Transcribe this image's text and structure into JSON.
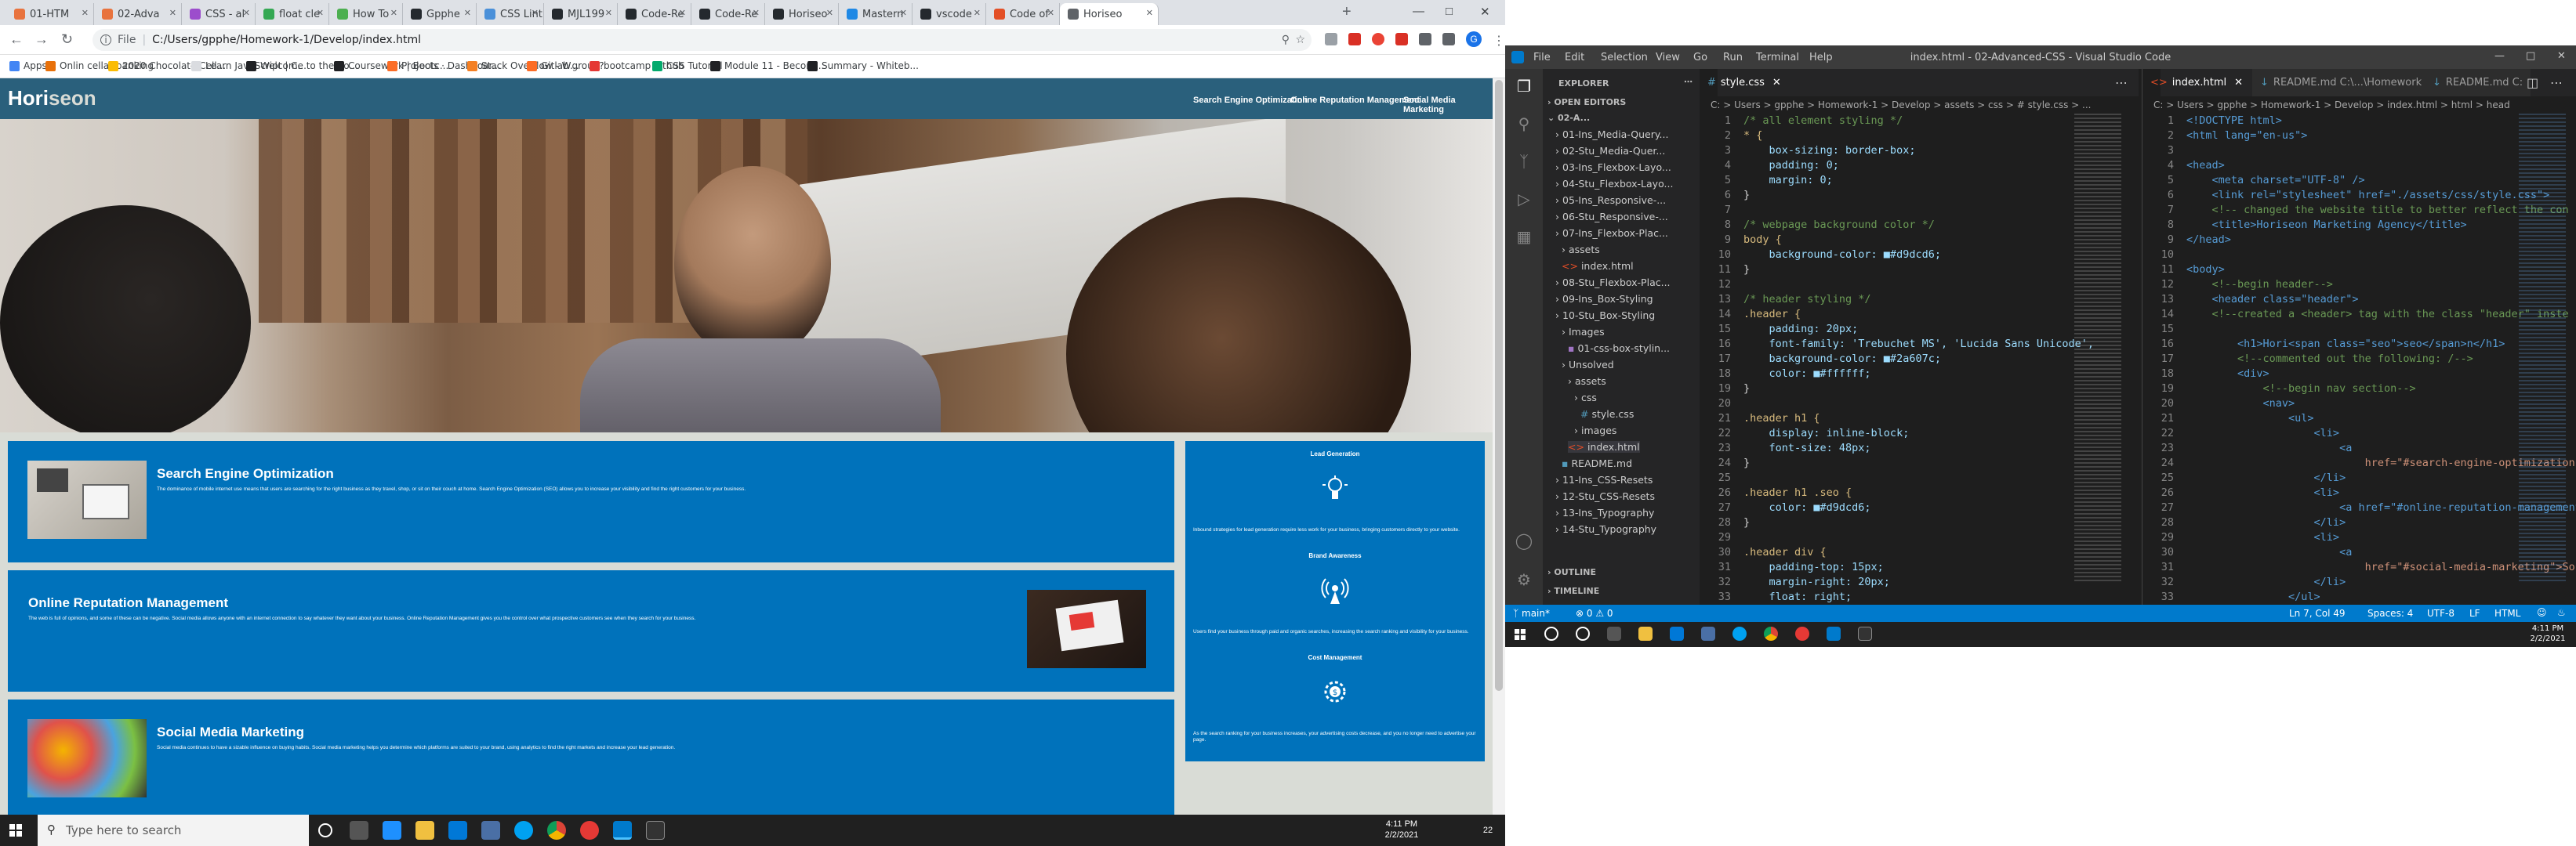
{
  "chrome": {
    "tabs": [
      {
        "label": "01-HTM",
        "color": "#e8733e"
      },
      {
        "label": "02-Adva",
        "color": "#e8733e"
      },
      {
        "label": "CSS - al",
        "color": "#9c4dcc"
      },
      {
        "label": "float cle",
        "color": "#34a853"
      },
      {
        "label": "How To",
        "color": "#4caf50"
      },
      {
        "label": "Gpphe",
        "color": "#24292e"
      },
      {
        "label": "CSS Lint",
        "color": "#4a90d9"
      },
      {
        "label": "MJL199",
        "color": "#24292e"
      },
      {
        "label": "Code-Re",
        "color": "#24292e"
      },
      {
        "label": "Code-Re",
        "color": "#24292e"
      },
      {
        "label": "Horiseo",
        "color": "#24292e"
      },
      {
        "label": "Mastern",
        "color": "#1e88e5"
      },
      {
        "label": "vscode",
        "color": "#24292e"
      },
      {
        "label": "Code of",
        "color": "#e34f26"
      },
      {
        "label": "Horiseo",
        "color": "#5f6368"
      }
    ],
    "address": "C:/Users/gpphe/Homework-1/Develop/index.html",
    "address_prefix": "File",
    "bookmarks": [
      {
        "label": "Apps",
        "color": "#4285f4"
      },
      {
        "label": "Onlin cellar banking",
        "color": "#e8710a"
      },
      {
        "label": "2020 Chocolate Cell...",
        "color": "#fbbc04"
      },
      {
        "label": "Learn JavaScript | C...",
        "color": "#dadce0"
      },
      {
        "label": "Welcome to the Bo...",
        "color": "#202124"
      },
      {
        "label": "Coursework | Bootc...",
        "color": "#202124"
      },
      {
        "label": "Projects · Dashboar...",
        "color": "#fc6d26"
      },
      {
        "label": "Stack Overflow - W...",
        "color": "#f48024"
      },
      {
        "label": "Gitlab group?",
        "color": "#fc6d26"
      },
      {
        "label": "bootcamp github",
        "color": "#e53935"
      },
      {
        "label": "CSS Tutorial",
        "color": "#04aa6d"
      },
      {
        "label": "Module 11 - Becom...",
        "color": "#202124"
      },
      {
        "label": "Summary - Whiteb...",
        "color": "#202124"
      }
    ]
  },
  "site": {
    "title": "Hori",
    "title_seo": "seon",
    "nav": [
      "Search Engine Optimization",
      "Online Reputation Management",
      "Social Media Marketing"
    ],
    "sections": [
      {
        "title": "Search Engine Optimization",
        "text": "The dominance of mobile internet use means that users are searching for the right business as they travel, shop, or sit on their couch at home. Search Engine Optimization (SEO) allows you to increase your visibility and find the right customers for your business."
      },
      {
        "title": "Online Reputation Management",
        "text": "The web is full of opinions, and some of these can be negative. Social media allows anyone with an internet connection to say whatever they want about your business. Online Reputation Management gives you the control over what prospective customers see when they search for your business."
      },
      {
        "title": "Social Media Marketing",
        "text": "Social media continues to have a sizable influence on buying habits. Social media marketing helps you determine which platforms are suited to your brand, using analytics to find the right markets and increase your lead generation."
      }
    ],
    "benefits": [
      {
        "title": "Lead Generation",
        "text": "Inbound strategies for lead generation require less work for your business, bringing customers directly to your website."
      },
      {
        "title": "Brand Awareness",
        "text": "Users find your business through paid and organic searches, increasing the search ranking and visibility for your business."
      },
      {
        "title": "Cost Management",
        "text": "As the search ranking for your business increases, your advertising costs decrease, and you no longer need to advertise your page."
      }
    ]
  },
  "taskbar": {
    "search_placeholder": "Type here to search",
    "time": "4:11 PM",
    "date": "2/2/2021",
    "notif_count": "22"
  },
  "vscode": {
    "title": "index.html - 02-Advanced-CSS - Visual Studio Code",
    "menu": [
      "File",
      "Edit",
      "Selection",
      "View",
      "Go",
      "Run",
      "Terminal",
      "Help"
    ],
    "explorer_title": "EXPLORER",
    "open_editors": "OPEN EDITORS",
    "folder": "02-A...",
    "tree": [
      "01-Ins_Media-Query...",
      "02-Stu_Media-Quer...",
      "03-Ins_Flexbox-Layo...",
      "04-Stu_Flexbox-Layo...",
      "05-Ins_Responsive-...",
      "06-Stu_Responsive-...",
      "07-Ins_Flexbox-Plac...",
      "assets",
      "index.html",
      "08-Stu_Flexbox-Plac...",
      "09-Ins_Box-Styling",
      "10-Stu_Box-Styling",
      "Images",
      "01-css-box-stylin...",
      "Unsolved",
      "assets",
      "css",
      "style.css",
      "images",
      "index.html",
      "README.md",
      "11-Ins_CSS-Resets",
      "12-Stu_CSS-Resets",
      "13-Ins_Typography",
      "14-Stu_Typography"
    ],
    "outline": "OUTLINE",
    "timeline": "TIMELINE",
    "left_tab": "style.css",
    "left_crumb": "C: > Users > gpphe > Homework-1 > Develop > assets > css > # style.css > ...",
    "left_code": [
      "/* all element styling */",
      "* {",
      "    box-sizing: border-box;",
      "    padding: 0;",
      "    margin: 0;",
      "}",
      "",
      "/* webpage background color */",
      "body {",
      "    background-color: ■#d9dcd6;",
      "}",
      "",
      "/* header styling */",
      ".header {",
      "    padding: 20px;",
      "    font-family: 'Trebuchet MS', 'Lucida Sans Unicode',",
      "    background-color: ■#2a607c;",
      "    color: ■#ffffff;",
      "}",
      "",
      ".header h1 {",
      "    display: inline-block;",
      "    font-size: 48px;",
      "}",
      "",
      ".header h1 .seo {",
      "    color: ■#d9dcd6;",
      "}",
      "",
      ".header div {",
      "    padding-top: 15px;",
      "    margin-right: 20px;",
      "    float: right;"
    ],
    "right_tabs": [
      "index.html",
      "README.md C:\\...\\Homework",
      "README.md C:"
    ],
    "right_crumb": "C: > Users > gpphe > Homework-1 > Develop > index.html > html > head",
    "right_code": [
      "<!DOCTYPE html>",
      "<html lang=\"en-us\">",
      "",
      "<head>",
      "    <meta charset=\"UTF-8\" />",
      "    <link rel=\"stylesheet\" href=\"./assets/css/style.css\">",
      "    <!-- changed the website title to better reflect the con",
      "    <title>Horiseon Marketing Agency</title>",
      "</head>",
      "",
      "<body>",
      "    <!--begin header-->",
      "    <header class=\"header\">",
      "    <!--created a <header> tag with the class \"header\" inste",
      "",
      "        <h1>Hori<span class=\"seo\">seo</span>n</h1>",
      "        <!--commented out the following: /-->",
      "        <div>",
      "            <!--begin nav section-->",
      "            <nav>",
      "                <ul>",
      "                    <li>",
      "                        <a",
      "                            href=\"#search-engine-optimization\">Searc",
      "                    </li>",
      "                    <li>",
      "                        <a href=\"#online-reputation-management\">",
      "                    </li>",
      "                    <li>",
      "                        <a",
      "                            href=\"#social-media-marketing\">Social Me",
      "                    </li>",
      "                </ul>"
    ],
    "status_left": "main*",
    "status_problems": "⊗ 0  ⚠ 0",
    "status_right": [
      "Ln 7, Col 49",
      "Spaces: 4",
      "UTF-8",
      "LF",
      "HTML"
    ],
    "time": "4:11 PM",
    "date": "2/2/2021"
  }
}
